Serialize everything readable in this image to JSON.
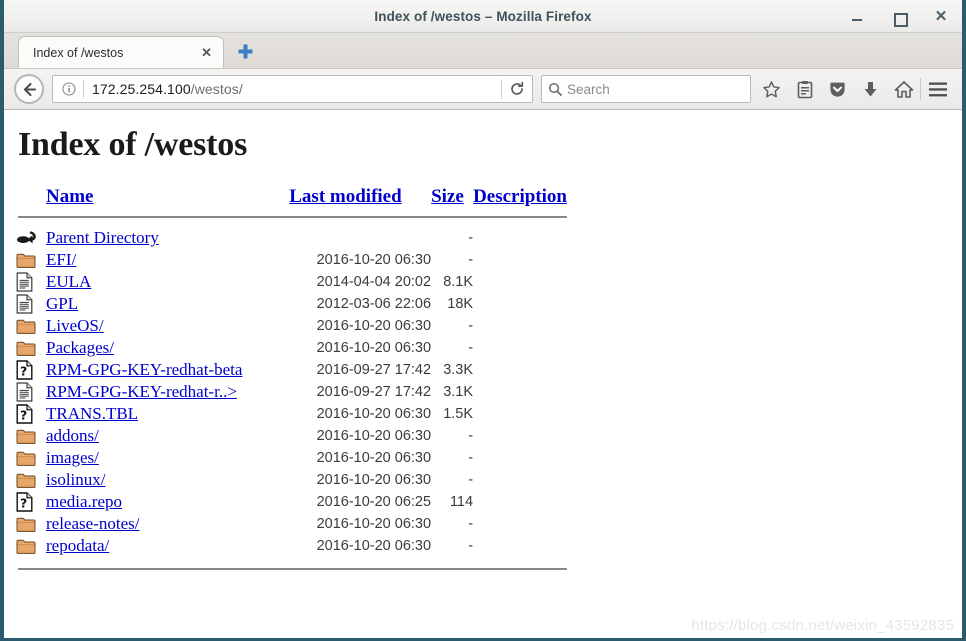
{
  "window": {
    "title": "Index of /westos – Mozilla Firefox",
    "controls": {
      "minimize": "–",
      "maximize": "□",
      "close": "✕"
    },
    "border_color": "#2a5c6e"
  },
  "tabbar": {
    "tab_label": "Index of /westos",
    "tab_close": "✕",
    "newtab_label": "+"
  },
  "navbar": {
    "back_icon": "back-arrow-icon",
    "identity_icon": "info-icon",
    "url_host": "172.25.254.100",
    "url_path": "/westos/",
    "reload_icon": "reload-icon",
    "search_placeholder": "Search",
    "search_value": "",
    "buttons": [
      {
        "name": "bookmark-star-icon",
        "label": "Bookmark"
      },
      {
        "name": "library-icon",
        "label": "Library"
      },
      {
        "name": "pocket-icon",
        "label": "Pocket"
      },
      {
        "name": "downloads-icon",
        "label": "Downloads"
      },
      {
        "name": "home-icon",
        "label": "Home"
      },
      {
        "name": "menu-icon",
        "label": "Open menu"
      }
    ]
  },
  "page": {
    "title": "Index of /westos",
    "columns": {
      "name": "Name",
      "last_modified": "Last modified",
      "size": "Size",
      "description": "Description"
    },
    "rows": [
      {
        "icon": "parent-directory-icon",
        "name": "Parent Directory",
        "date": "",
        "size": "-",
        "desc": ""
      },
      {
        "icon": "folder-icon",
        "name": "EFI/",
        "date": "2016-10-20 06:30",
        "size": "-",
        "desc": ""
      },
      {
        "icon": "document-icon",
        "name": "EULA",
        "date": "2014-04-04 20:02",
        "size": "8.1K",
        "desc": ""
      },
      {
        "icon": "document-icon",
        "name": "GPL",
        "date": "2012-03-06 22:06",
        "size": "18K",
        "desc": ""
      },
      {
        "icon": "folder-icon",
        "name": "LiveOS/",
        "date": "2016-10-20 06:30",
        "size": "-",
        "desc": ""
      },
      {
        "icon": "folder-icon",
        "name": "Packages/",
        "date": "2016-10-20 06:30",
        "size": "-",
        "desc": ""
      },
      {
        "icon": "unknown-file-icon",
        "name": "RPM-GPG-KEY-redhat-beta",
        "date": "2016-09-27 17:42",
        "size": "3.3K",
        "desc": ""
      },
      {
        "icon": "document-icon",
        "name": "RPM-GPG-KEY-redhat-r..>",
        "date": "2016-09-27 17:42",
        "size": "3.1K",
        "desc": ""
      },
      {
        "icon": "unknown-file-icon",
        "name": "TRANS.TBL",
        "date": "2016-10-20 06:30",
        "size": "1.5K",
        "desc": ""
      },
      {
        "icon": "folder-icon",
        "name": "addons/",
        "date": "2016-10-20 06:30",
        "size": "-",
        "desc": ""
      },
      {
        "icon": "folder-icon",
        "name": "images/",
        "date": "2016-10-20 06:30",
        "size": "-",
        "desc": ""
      },
      {
        "icon": "folder-icon",
        "name": "isolinux/",
        "date": "2016-10-20 06:30",
        "size": "-",
        "desc": ""
      },
      {
        "icon": "unknown-file-icon",
        "name": "media.repo",
        "date": "2016-10-20 06:25",
        "size": "114",
        "desc": ""
      },
      {
        "icon": "folder-icon",
        "name": "release-notes/",
        "date": "2016-10-20 06:30",
        "size": "-",
        "desc": ""
      },
      {
        "icon": "folder-icon",
        "name": "repodata/",
        "date": "2016-10-20 06:30",
        "size": "-",
        "desc": ""
      }
    ],
    "link_color": "#0000cc"
  },
  "watermark": "https://blog.csdn.net/weixin_43592835"
}
